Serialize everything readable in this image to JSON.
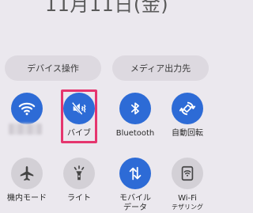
{
  "header": {
    "date_text": "11月11日(金)"
  },
  "buttons": {
    "device_control": "デバイス操作",
    "media_output": "メディア出力先"
  },
  "tiles": {
    "wifi": {
      "label": "",
      "icon": "wifi-icon",
      "state": "on"
    },
    "vibrate": {
      "label": "バイブ",
      "icon": "vibrate-icon",
      "state": "on"
    },
    "bluetooth": {
      "label": "Bluetooth",
      "icon": "bluetooth-icon",
      "state": "on"
    },
    "auto_rotate": {
      "label": "自動回転",
      "icon": "auto-rotate-icon",
      "state": "on"
    },
    "airplane": {
      "label": "機内モード",
      "icon": "airplane-icon",
      "state": "off"
    },
    "flashlight": {
      "label": "ライト",
      "icon": "flashlight-icon",
      "state": "off"
    },
    "mobile_data": {
      "label_line1": "モバイル",
      "label_line2": "データ",
      "icon": "mobile-data-icon",
      "state": "on"
    },
    "wifi_calling": {
      "label_line1": "Wi-Fi",
      "label_line2": "テザリング",
      "icon": "wifi-calling-icon",
      "state": "off"
    }
  },
  "colors": {
    "tile_on": "#2d6bd6",
    "tile_off": "#d3d0d6",
    "highlight": "#e5356e",
    "background": "#ebe8ee"
  }
}
